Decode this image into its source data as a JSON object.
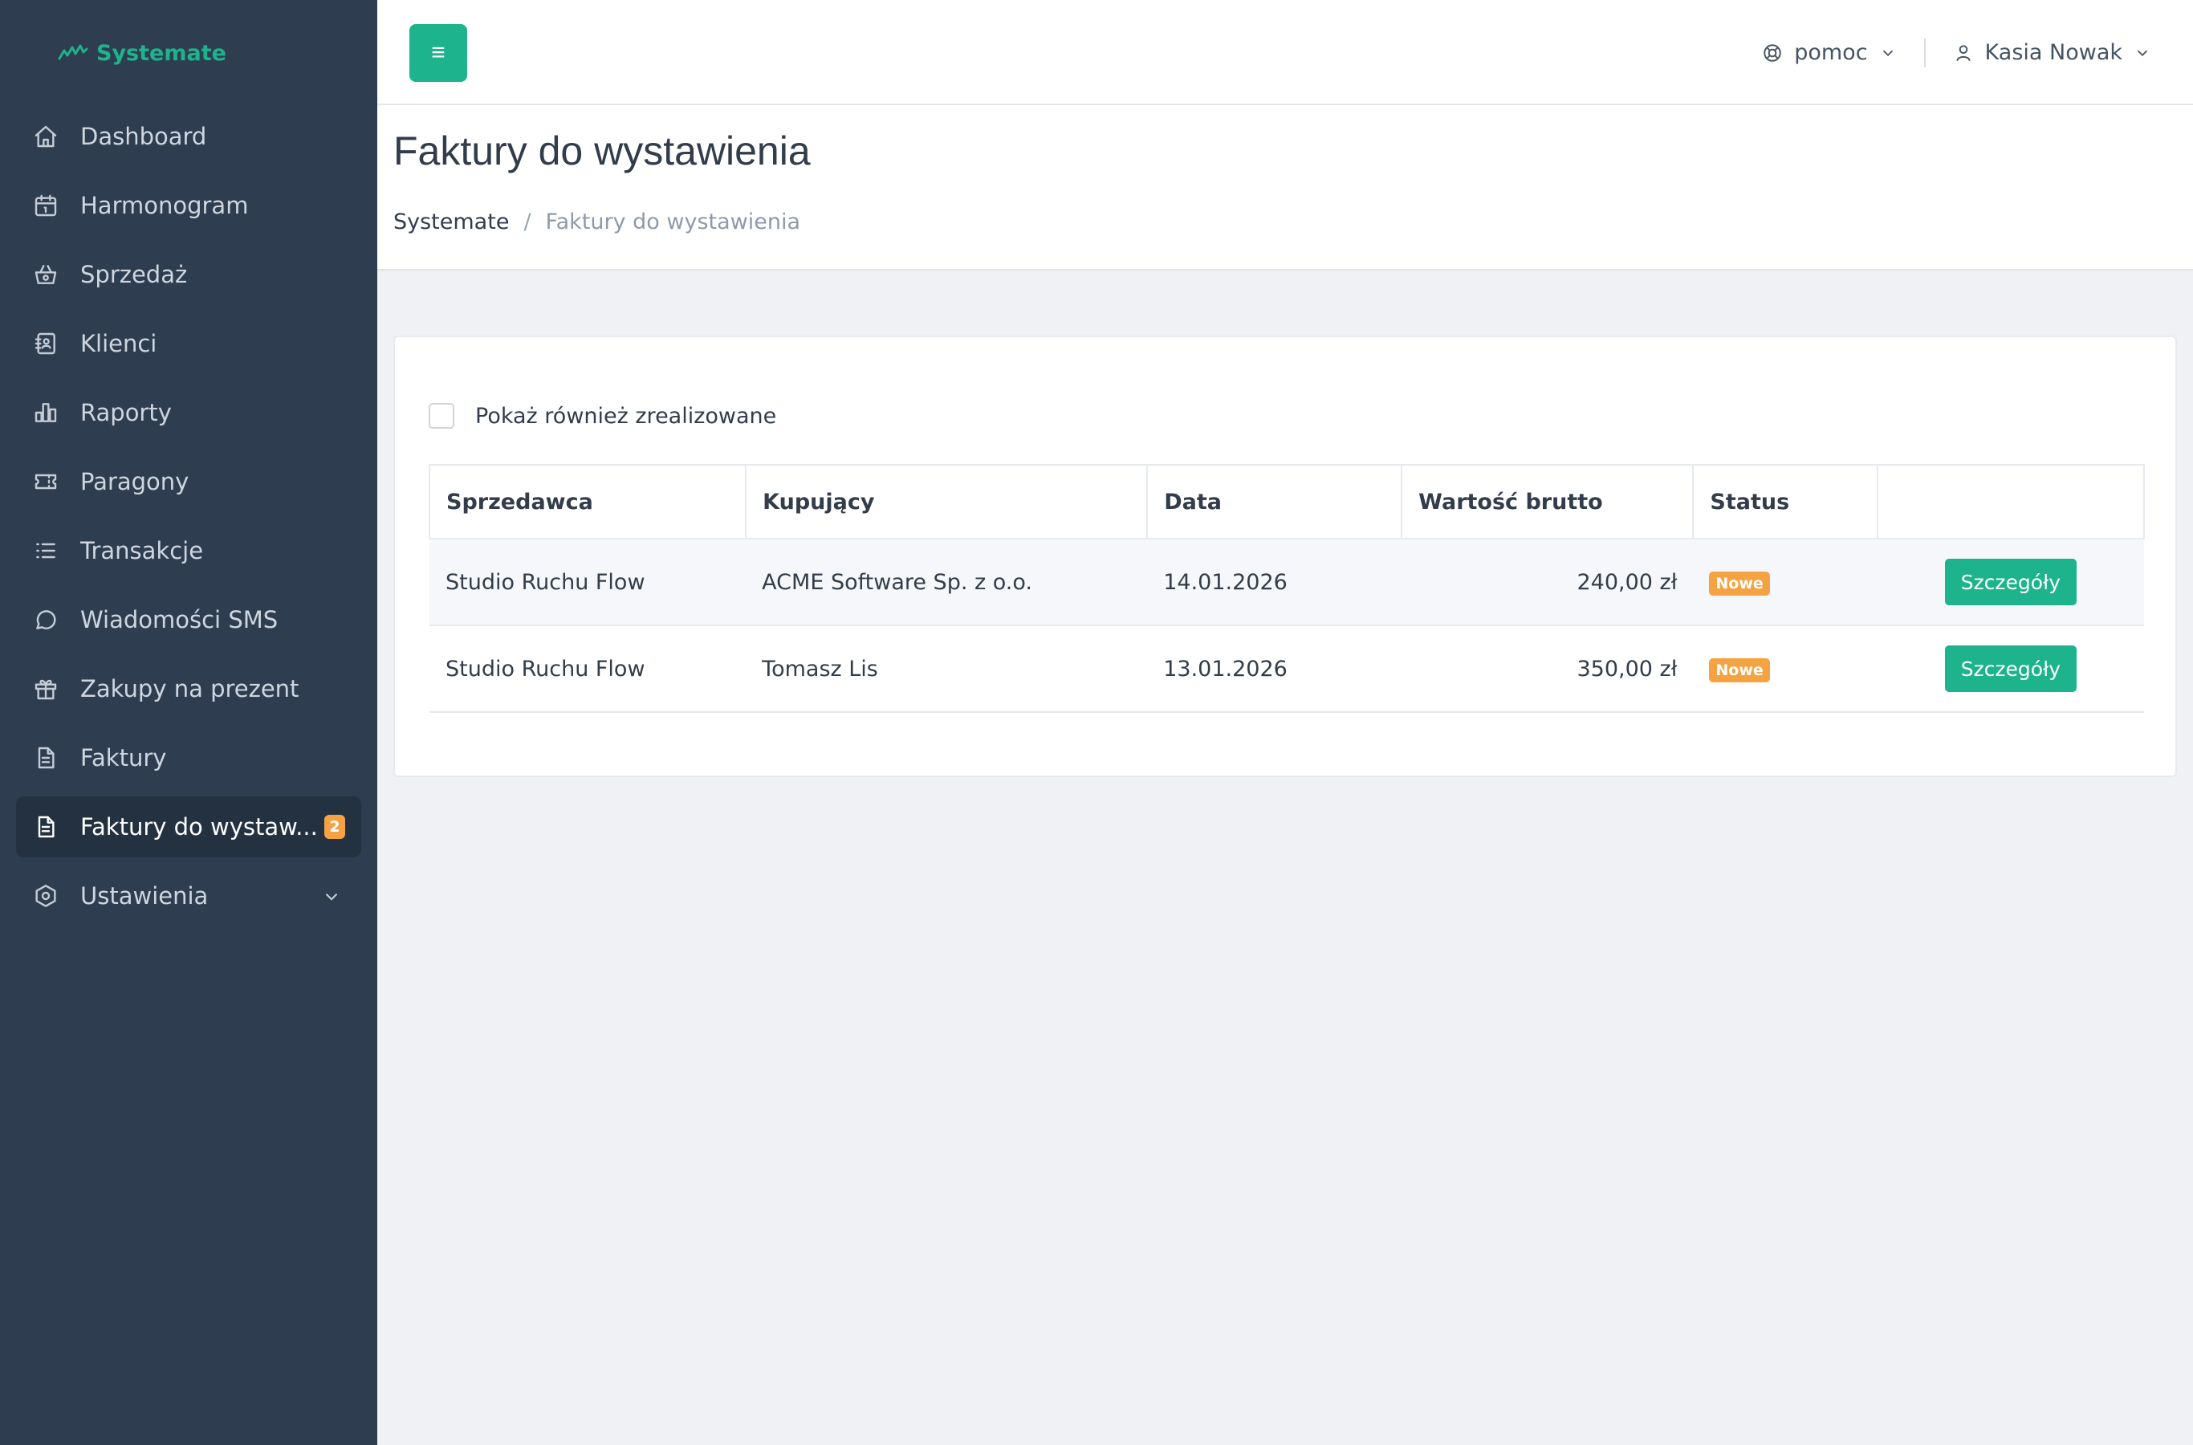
{
  "brand": {
    "name": "Systemate"
  },
  "sidebar": {
    "items": [
      {
        "label": "Dashboard",
        "icon": "home-icon"
      },
      {
        "label": "Harmonogram",
        "icon": "calendar-icon"
      },
      {
        "label": "Sprzedaż",
        "icon": "basket-icon"
      },
      {
        "label": "Klienci",
        "icon": "address-book-icon"
      },
      {
        "label": "Raporty",
        "icon": "bar-chart-icon"
      },
      {
        "label": "Paragony",
        "icon": "ticket-icon"
      },
      {
        "label": "Transakcje",
        "icon": "list-icon"
      },
      {
        "label": "Wiadomości SMS",
        "icon": "message-icon"
      },
      {
        "label": "Zakupy na prezent",
        "icon": "gift-icon"
      },
      {
        "label": "Faktury",
        "icon": "document-icon"
      },
      {
        "label": "Faktury do wystaw...",
        "icon": "document-icon",
        "badge": "2",
        "active": true
      },
      {
        "label": "Ustawienia",
        "icon": "settings-icon"
      }
    ]
  },
  "topbar": {
    "menu_glyph": "≡",
    "help_label": "pomoc",
    "user_name": "Kasia Nowak"
  },
  "page": {
    "title": "Faktury do wystawienia",
    "breadcrumb_root": "Systemate",
    "breadcrumb_sep": "/",
    "breadcrumb_current": "Faktury do wystawienia"
  },
  "filter": {
    "show_completed_label": "Pokaż również zrealizowane"
  },
  "table": {
    "headers": [
      "Sprzedawca",
      "Kupujący",
      "Data",
      "Wartość brutto",
      "Status",
      ""
    ],
    "rows": [
      {
        "seller": "Studio Ruchu Flow",
        "buyer": "ACME Software Sp. z o.o.",
        "date": "14.01.2026",
        "gross": "240,00 zł",
        "status": "Nowe",
        "action": "Szczegóły"
      },
      {
        "seller": "Studio Ruchu Flow",
        "buyer": "Tomasz Lis",
        "date": "13.01.2026",
        "gross": "350,00 zł",
        "status": "Nowe",
        "action": "Szczegóły"
      }
    ]
  },
  "colors": {
    "accent": "#1db38d",
    "sidebar_bg": "#2e3e50",
    "badge": "#f5a342"
  }
}
